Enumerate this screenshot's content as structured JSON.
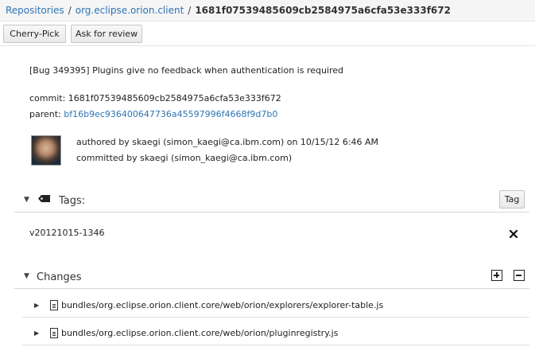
{
  "breadcrumb": {
    "repositories": "Repositories",
    "separator": "/",
    "repo": "org.eclipse.orion.client",
    "commit": "1681f07539485609cb2584975a6cfa53e333f672"
  },
  "toolbar": {
    "cherry_pick": "Cherry-Pick",
    "ask_review": "Ask for review"
  },
  "commit": {
    "subject": "[Bug 349395] Plugins give no feedback when authentication is required",
    "commit_label": "commit:",
    "commit_id": "1681f07539485609cb2584975a6cfa53e333f672",
    "parent_label": "parent:",
    "parent_id": "bf16b9ec936400647736a45597996f4668f9d7b0",
    "authored": "authored by skaegi (simon_kaegi@ca.ibm.com) on 10/15/12 6:46 AM",
    "committed": "committed by skaegi (simon_kaegi@ca.ibm.com)"
  },
  "tags": {
    "title": "Tags:",
    "button": "Tag",
    "items": [
      "v20121015-1346"
    ]
  },
  "changes": {
    "title": "Changes",
    "files": [
      {
        "path": "bundles/org.eclipse.orion.client.core/web/orion/explorers/explorer-table.js"
      },
      {
        "path": "bundles/org.eclipse.orion.client.core/web/orion/pluginregistry.js"
      }
    ]
  },
  "colors": {
    "link": "#2e74b5",
    "header_bg": "#f5f5f5"
  },
  "icons": [
    "tag-icon",
    "close-icon",
    "expand-all-icon",
    "collapse-all-icon",
    "file-icon"
  ]
}
